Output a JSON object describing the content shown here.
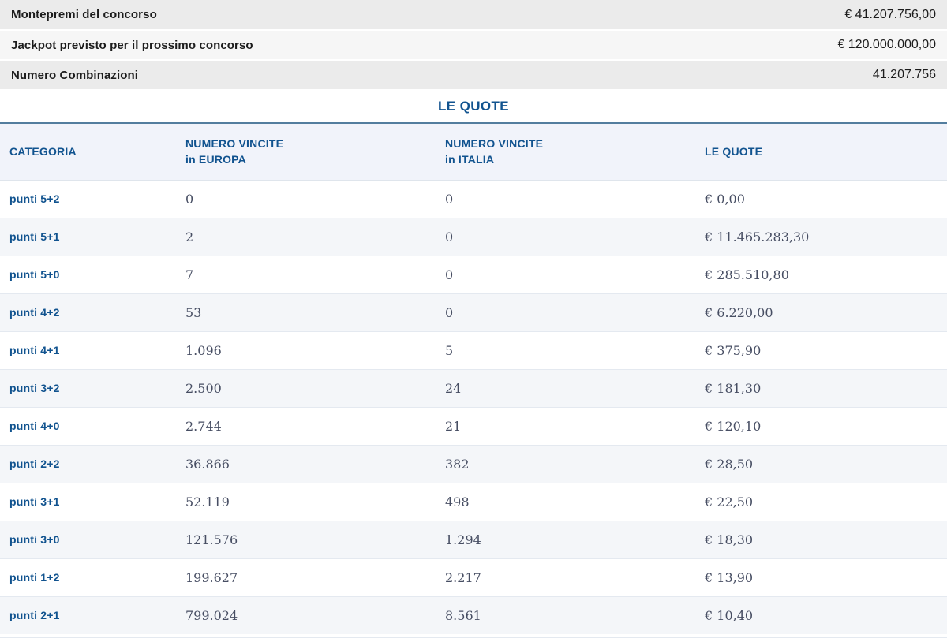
{
  "colors": {
    "accent_blue": "#11538f",
    "divider_blue": "#537d9e",
    "serif_value_text": "#474e63",
    "summary_text": "#1c1c1c",
    "summary_bg_dark": "#ebebeb",
    "summary_bg_light": "#f6f6f6",
    "table_header_bg": "#f1f3fa",
    "row_stripe_bg": "#f4f6f9"
  },
  "summary": {
    "rows": [
      {
        "label": "Montepremi del concorso",
        "value": "€ 41.207.756,00"
      },
      {
        "label": "Jackpot previsto per il prossimo concorso",
        "value": "€ 120.000.000,00"
      },
      {
        "label": "Numero Combinazioni",
        "value": "41.207.756"
      }
    ]
  },
  "section_title": "LE QUOTE",
  "table": {
    "headers": [
      {
        "line1": "CATEGORIA",
        "line2": ""
      },
      {
        "line1": "NUMERO VINCITE",
        "line2": "in EUROPA"
      },
      {
        "line1": "NUMERO VINCITE",
        "line2": "in ITALIA"
      },
      {
        "line1": "LE QUOTE",
        "line2": ""
      }
    ],
    "rows": [
      {
        "category": "punti 5+2",
        "wins_europe": "0",
        "wins_italy": "0",
        "quote": "€ 0,00"
      },
      {
        "category": "punti 5+1",
        "wins_europe": "2",
        "wins_italy": "0",
        "quote": "€ 11.465.283,30"
      },
      {
        "category": "punti 5+0",
        "wins_europe": "7",
        "wins_italy": "0",
        "quote": "€ 285.510,80"
      },
      {
        "category": "punti 4+2",
        "wins_europe": "53",
        "wins_italy": "0",
        "quote": "€ 6.220,00"
      },
      {
        "category": "punti 4+1",
        "wins_europe": "1.096",
        "wins_italy": "5",
        "quote": "€ 375,90"
      },
      {
        "category": "punti 3+2",
        "wins_europe": "2.500",
        "wins_italy": "24",
        "quote": "€ 181,30"
      },
      {
        "category": "punti 4+0",
        "wins_europe": "2.744",
        "wins_italy": "21",
        "quote": "€ 120,10"
      },
      {
        "category": "punti 2+2",
        "wins_europe": "36.866",
        "wins_italy": "382",
        "quote": "€ 28,50"
      },
      {
        "category": "punti 3+1",
        "wins_europe": "52.119",
        "wins_italy": "498",
        "quote": "€ 22,50"
      },
      {
        "category": "punti 3+0",
        "wins_europe": "121.576",
        "wins_italy": "1.294",
        "quote": "€ 18,30"
      },
      {
        "category": "punti 1+2",
        "wins_europe": "199.627",
        "wins_italy": "2.217",
        "quote": "€ 13,90"
      },
      {
        "category": "punti 2+1",
        "wins_europe": "799.024",
        "wins_italy": "8.561",
        "quote": "€ 10,40"
      }
    ]
  }
}
